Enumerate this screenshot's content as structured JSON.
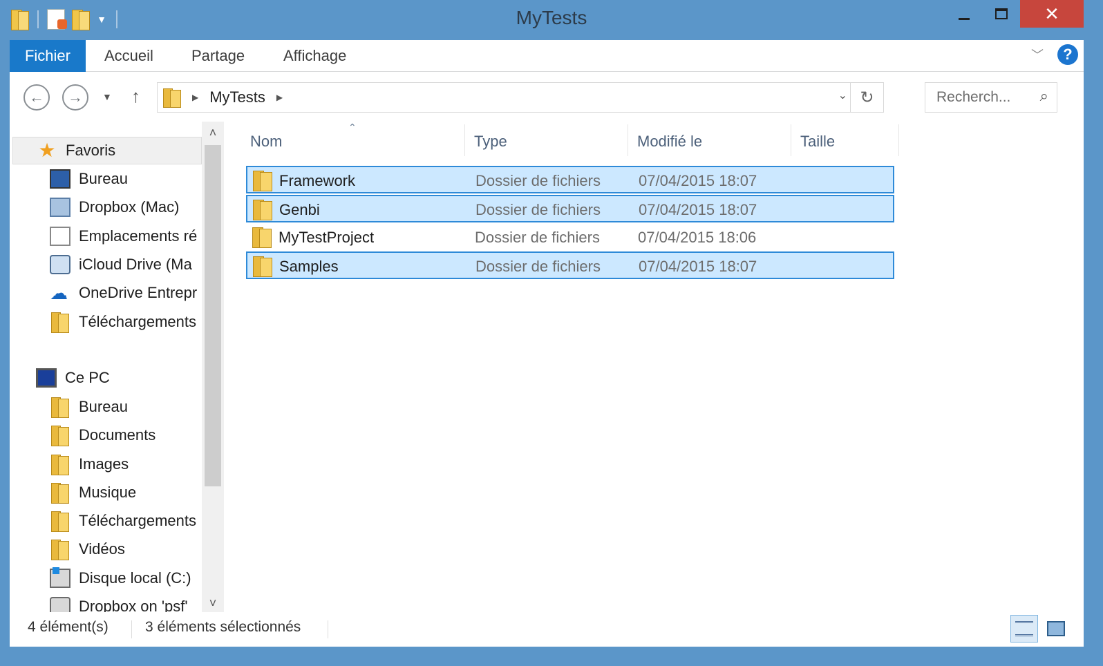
{
  "window": {
    "title": "MyTests",
    "caption": {
      "close": "✕"
    }
  },
  "ribbon": {
    "tabs": [
      "Fichier",
      "Accueil",
      "Partage",
      "Affichage"
    ],
    "help": "?"
  },
  "addressbar": {
    "crumbs": [
      "MyTests"
    ],
    "search_placeholder": "Recherch..."
  },
  "navigation": {
    "favorites_label": "Favoris",
    "favorites": [
      {
        "label": "Bureau",
        "icon": "desktop-icon"
      },
      {
        "label": "Dropbox (Mac)",
        "icon": "dropbox-icon"
      },
      {
        "label": "Emplacements ré",
        "icon": "recent-places-icon"
      },
      {
        "label": "iCloud Drive (Ma",
        "icon": "icloud-icon"
      },
      {
        "label": "OneDrive Entrepr",
        "icon": "onedrive-icon"
      },
      {
        "label": "Téléchargements",
        "icon": "downloads-icon"
      }
    ],
    "pc_label": "Ce PC",
    "pc": [
      {
        "label": "Bureau",
        "icon": "desktop-folder-icon"
      },
      {
        "label": "Documents",
        "icon": "documents-icon"
      },
      {
        "label": "Images",
        "icon": "images-icon"
      },
      {
        "label": "Musique",
        "icon": "music-icon"
      },
      {
        "label": "Téléchargements",
        "icon": "downloads-icon"
      },
      {
        "label": "Vidéos",
        "icon": "videos-icon"
      },
      {
        "label": "Disque local (C:)",
        "icon": "local-disk-icon"
      },
      {
        "label": "Dropbox on 'psf'",
        "icon": "network-drive-icon"
      }
    ]
  },
  "columns": [
    "Nom",
    "Type",
    "Modifié le",
    "Taille"
  ],
  "files": [
    {
      "name": "Framework",
      "type": "Dossier de fichiers",
      "modified": "07/04/2015 18:07",
      "size": "",
      "selected": true
    },
    {
      "name": "Genbi",
      "type": "Dossier de fichiers",
      "modified": "07/04/2015 18:07",
      "size": "",
      "selected": true
    },
    {
      "name": "MyTestProject",
      "type": "Dossier de fichiers",
      "modified": "07/04/2015 18:06",
      "size": "",
      "selected": false
    },
    {
      "name": "Samples",
      "type": "Dossier de fichiers",
      "modified": "07/04/2015 18:07",
      "size": "",
      "selected": true
    }
  ],
  "status": {
    "count": "4 élément(s)",
    "selection": "3 éléments sélectionnés"
  },
  "colors": {
    "window_frame": "#5b96c9",
    "file_tab": "#1979ca",
    "selection": "#cce8ff",
    "close_button": "#c7463d"
  }
}
